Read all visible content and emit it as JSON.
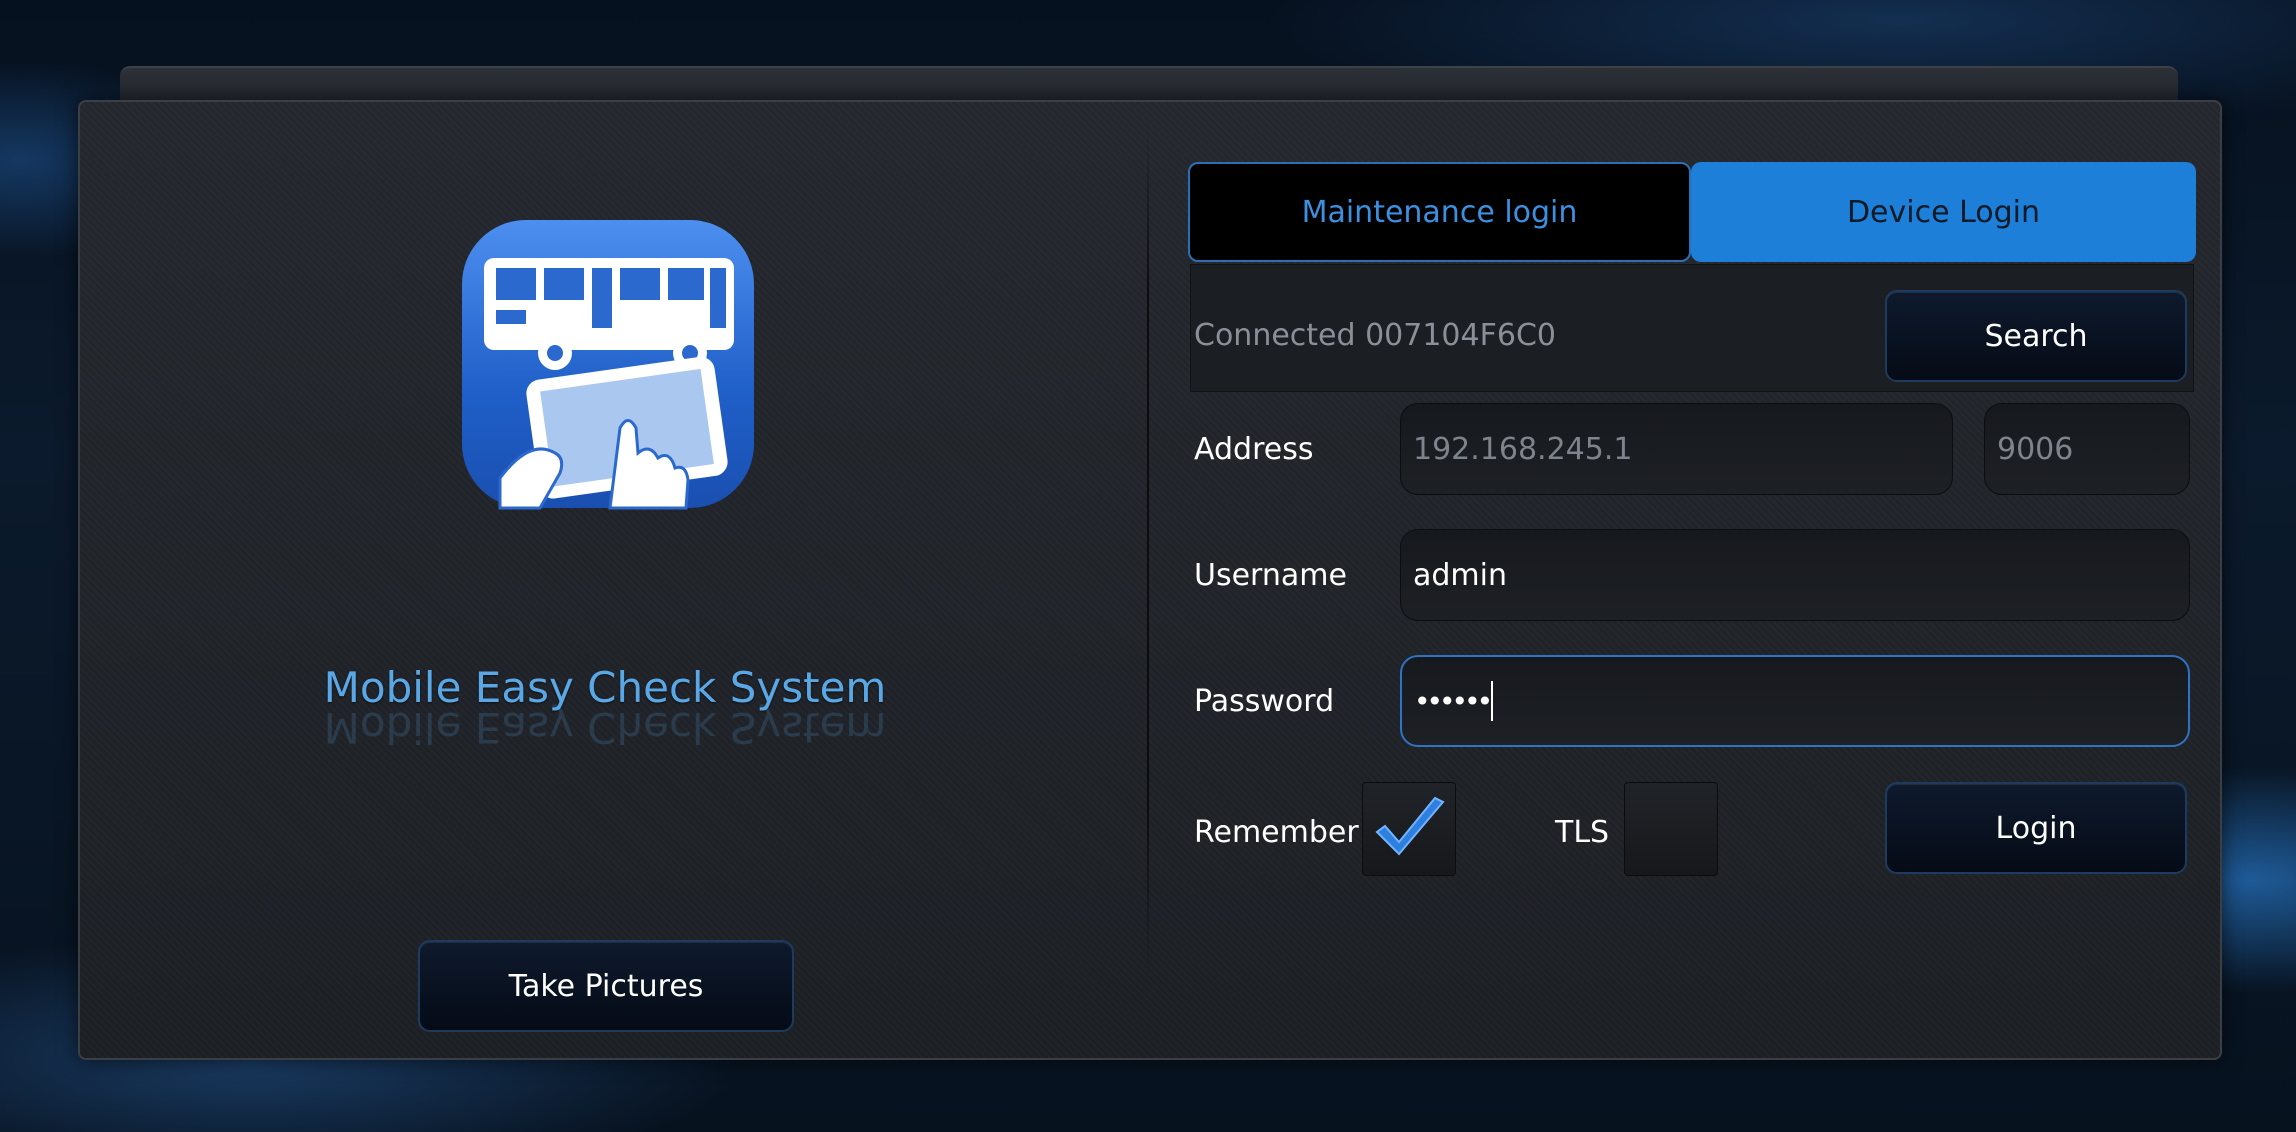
{
  "app": {
    "title": "Mobile Easy Check System",
    "take_pictures_label": "Take Pictures"
  },
  "tabs": [
    {
      "label": "Maintenance login",
      "selected": false
    },
    {
      "label": "Device Login",
      "selected": true
    }
  ],
  "connection": {
    "status_text": "Connected 007104F6C0",
    "search_label": "Search"
  },
  "form": {
    "address_label": "Address",
    "address_value": "192.168.245.1",
    "port_value": "9006",
    "username_label": "Username",
    "username_value": "admin",
    "password_label": "Password",
    "password_masked": "••••••",
    "remember_label": "Remember",
    "remember_checked": true,
    "tls_label": "TLS",
    "tls_checked": false,
    "login_label": "Login"
  },
  "colors": {
    "accent": "#1d7fd8",
    "title": "#5aa7e6",
    "panel": "#202328"
  },
  "icons": {
    "app_icon": "bus-tablet-icon",
    "checkmark": "checkmark-icon"
  }
}
